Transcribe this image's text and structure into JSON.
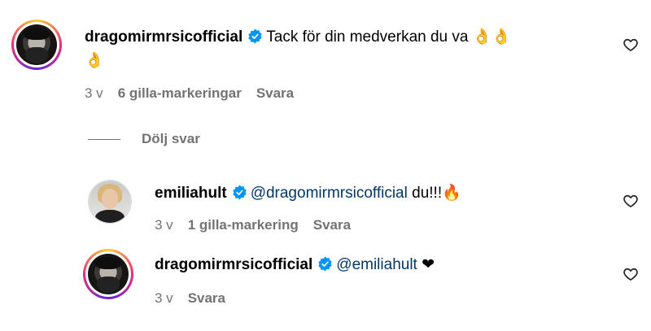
{
  "comments": [
    {
      "username": "dragomirmrsicofficial",
      "text_line1": "Tack för din medverkan du va 👌👌",
      "text_line2": "👌",
      "time": "3 v",
      "likes": "6 gilla-markeringar",
      "reply": "Svara",
      "avatar": "dark-bearded-man"
    }
  ],
  "divider": {
    "label": "Dölj svar"
  },
  "replies": [
    {
      "username": "emiliahult",
      "mention": "@dragomirmrsicofficial",
      "text": "du!!!🔥",
      "time": "3 v",
      "likes": "1 gilla-markering",
      "reply": "Svara",
      "avatar": "blonde-woman"
    },
    {
      "username": "dragomirmrsicofficial",
      "mention": "@emiliahult",
      "text": "❤",
      "time": "3 v",
      "reply": "Svara",
      "avatar": "dark-bearded-man"
    }
  ],
  "icons": {
    "verified": "verified-badge-icon",
    "like": "heart-icon",
    "accent_blue": "#0095f6",
    "mention_color": "#00376b",
    "meta_gray": "#737373"
  }
}
